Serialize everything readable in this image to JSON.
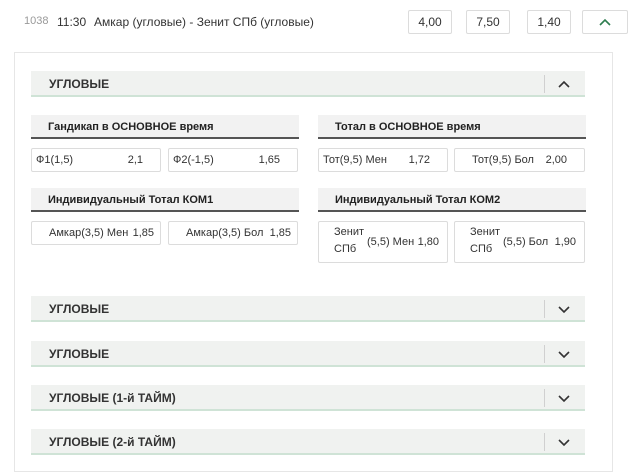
{
  "match": {
    "id": "1038",
    "time": "11:30",
    "title": "Амкар (угловые) - Зенит СПб (угловые)",
    "odds": [
      "4,00",
      "7,50",
      "1,40"
    ]
  },
  "sections": {
    "expanded_title": "УГЛОВЫЕ",
    "collapsed": [
      "УГЛОВЫЕ",
      "УГЛОВЫЕ",
      "УГЛОВЫЕ (1-й ТАЙМ)",
      "УГЛОВЫЕ (2-й ТАЙМ)"
    ]
  },
  "markets": {
    "handicap": {
      "title": "Гандикап в ОСНОВНОЕ время",
      "outcomes": [
        {
          "name": "Ф1(1,5)",
          "odd": "2,1"
        },
        {
          "name": "Ф2(-1,5)",
          "odd": "1,65"
        }
      ]
    },
    "total": {
      "title": "Тотал в ОСНОВНОЕ время",
      "outcomes": [
        {
          "name": "Тот(9,5) Мен",
          "odd": "1,72"
        },
        {
          "name": "Тот(9,5) Бол",
          "odd": "2,00"
        }
      ]
    },
    "ind_total_1": {
      "title": "Индивидуальный Тотал КОМ1",
      "outcomes": [
        {
          "name": "Амкар(3,5) Мен",
          "odd": "1,85"
        },
        {
          "name": "Амкар(3,5) Бол",
          "odd": "1,85"
        }
      ]
    },
    "ind_total_2": {
      "title": "Индивидуальный Тотал КОМ2",
      "outcomes": [
        {
          "team_line1": "Зенит",
          "team_line2": "СПб",
          "line": "(5,5) Мен",
          "odd": "1,80"
        },
        {
          "team_line1": "Зенит",
          "team_line2": "СПб",
          "line": "(5,5) Бол",
          "odd": "1,90"
        }
      ]
    }
  },
  "icons": {
    "expand": "chevron-down-icon",
    "collapse": "chevron-up-icon"
  },
  "colors": {
    "section_bg": "#f0f2f0",
    "section_underline": "#cfe3d6",
    "chevron_up_green": "#2e7d4f"
  }
}
